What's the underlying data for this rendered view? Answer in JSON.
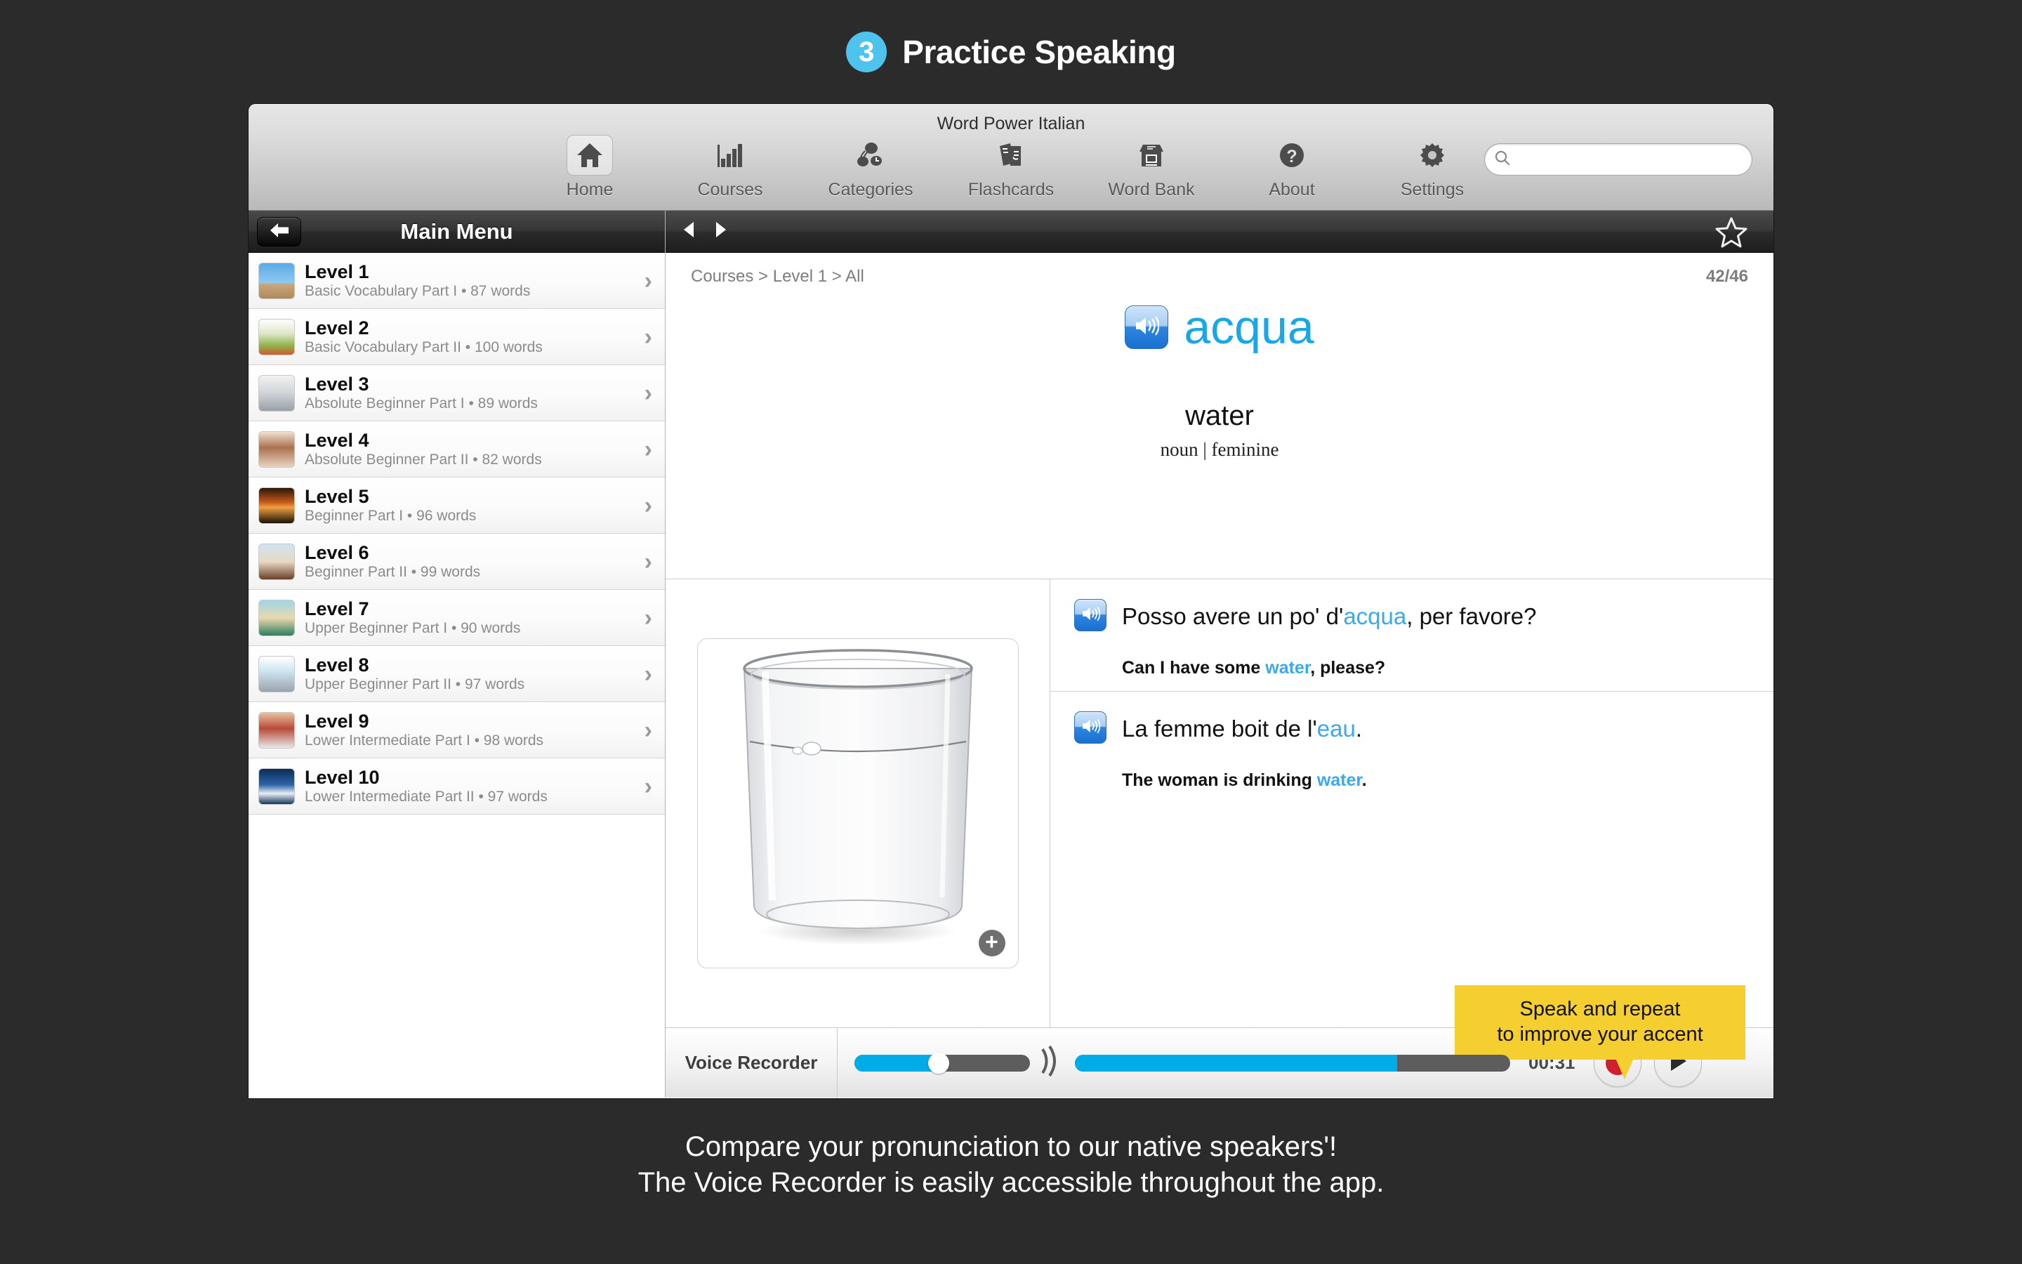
{
  "promo": {
    "step_number": "3",
    "title": "Practice Speaking",
    "caption_line1": "Compare your pronunciation to our native speakers'!",
    "caption_line2": "The Voice Recorder is easily accessible throughout the app."
  },
  "toolbar": {
    "app_title": "Word Power Italian",
    "items": [
      {
        "label": "Home",
        "icon": "home-icon",
        "active": true
      },
      {
        "label": "Courses",
        "icon": "bar-chart-icon",
        "active": false
      },
      {
        "label": "Categories",
        "icon": "categories-icon",
        "active": false
      },
      {
        "label": "Flashcards",
        "icon": "flashcards-icon",
        "active": false
      },
      {
        "label": "Word Bank",
        "icon": "word-bank-icon",
        "active": false
      },
      {
        "label": "About",
        "icon": "question-mark-icon",
        "active": false
      },
      {
        "label": "Settings",
        "icon": "gear-icon",
        "active": false
      }
    ],
    "search": {
      "value": "",
      "placeholder": ""
    }
  },
  "sidebar": {
    "header_title": "Main Menu",
    "back_label": "Back",
    "levels": [
      {
        "name": "Level 1",
        "sub": "Basic Vocabulary Part I • 87 words"
      },
      {
        "name": "Level 2",
        "sub": "Basic Vocabulary Part II • 100 words"
      },
      {
        "name": "Level 3",
        "sub": "Absolute Beginner Part I • 89 words"
      },
      {
        "name": "Level 4",
        "sub": "Absolute Beginner Part II • 82 words"
      },
      {
        "name": "Level 5",
        "sub": "Beginner Part I • 96 words"
      },
      {
        "name": "Level 6",
        "sub": "Beginner Part II • 99 words"
      },
      {
        "name": "Level 7",
        "sub": "Upper Beginner Part I • 90 words"
      },
      {
        "name": "Level 8",
        "sub": "Upper Beginner Part II • 97 words"
      },
      {
        "name": "Level 9",
        "sub": "Lower Intermediate Part I • 98 words"
      },
      {
        "name": "Level 10",
        "sub": "Lower Intermediate Part II • 97 words"
      }
    ]
  },
  "card": {
    "breadcrumb": "Courses > Level 1 > All",
    "counter": "42/46",
    "headword": "acqua",
    "translation": "water",
    "pos_gender": "noun | feminine",
    "image_alt": "glass-of-water",
    "sentences": [
      {
        "target_pre": "Posso avere un po' d'",
        "target_hl": "acqua",
        "target_post": ", per favore?",
        "native_pre": "Can I have some ",
        "native_hl": "water",
        "native_post": ", please?"
      },
      {
        "target_pre": "La femme boit de l'",
        "target_hl": "eau",
        "target_post": ".",
        "native_pre": "The woman is drinking ",
        "native_hl": "water",
        "native_post": "."
      }
    ]
  },
  "callout": {
    "line1": "Speak and repeat",
    "line2": "to improve your accent"
  },
  "recorder": {
    "label": "Voice Recorder",
    "time": "00:31",
    "volume_percent": 48,
    "progress_percent": 74,
    "record_label": "Record",
    "play_label": "Play"
  },
  "colors": {
    "accent_blue": "#1aa7e8",
    "slider_blue": "#00ace6",
    "callout_yellow": "#f4cf2f",
    "record_red": "#cf2030",
    "step_badge": "#4ec3ee"
  }
}
